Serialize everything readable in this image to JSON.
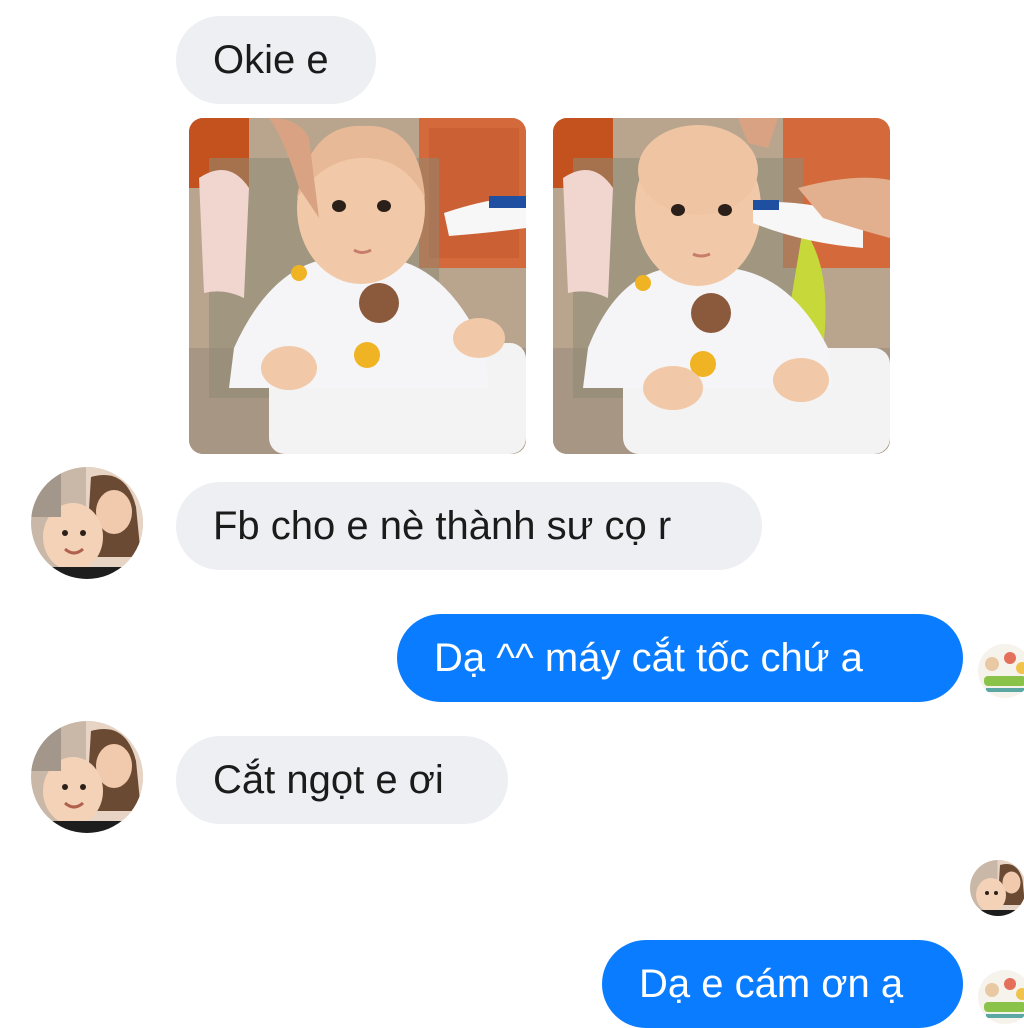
{
  "messages": [
    {
      "text": "Okie e"
    },
    {
      "text": "Fb cho e nè thành sư cọ r"
    },
    {
      "text": "Dạ ^^ máy cắt tốc chứ a"
    },
    {
      "text": "Cắt ngọt e ơi"
    },
    {
      "text": "Dạ e cám ơn ạ"
    }
  ],
  "photos": [
    {
      "subject": "baby with hair, trimmer at head"
    },
    {
      "subject": "baby with shaved head, trimmer at head"
    }
  ],
  "colors": {
    "incoming_bubble": "#eeeff3",
    "outgoing_bubble": "#0a7cff",
    "incoming_text": "#1b1b1b",
    "outgoing_text": "#ffffff"
  },
  "icons": {
    "contact_avatar": "avatar-icon",
    "read_receipt": "seen-avatar-icon"
  }
}
